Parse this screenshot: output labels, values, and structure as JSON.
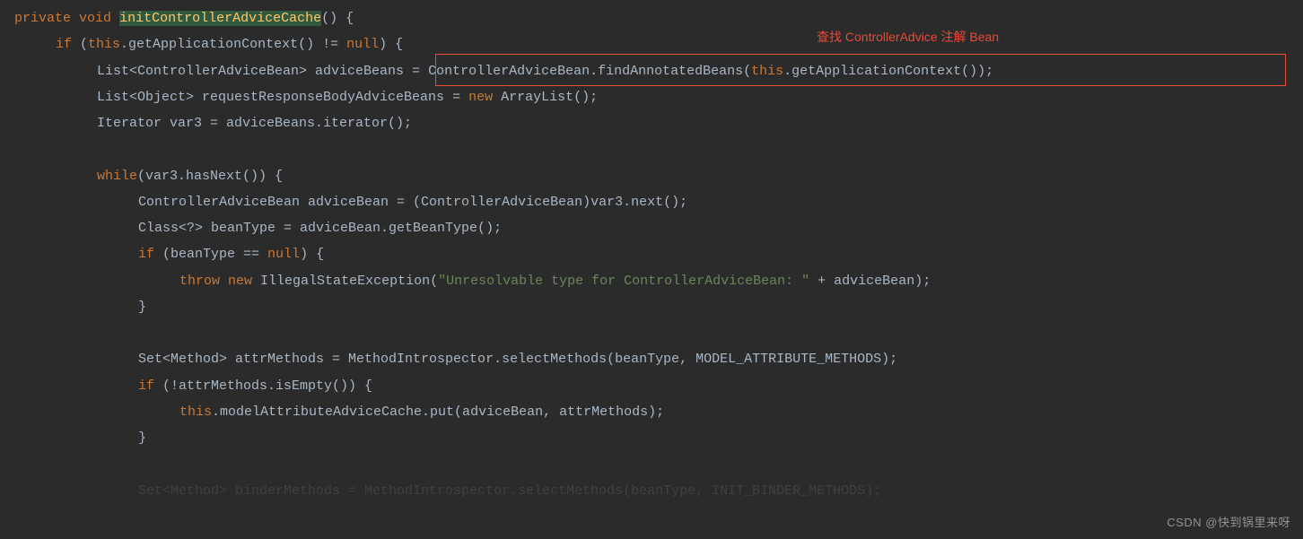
{
  "code": {
    "l1_private": "private",
    "l1_void": "void",
    "l1_method": "initControllerAdviceCache",
    "l1_rest": "() {",
    "l2_if": "if",
    "l2_open": " (",
    "l2_this1": "this",
    "l2_mid": ".getApplicationContext() != ",
    "l2_null": "null",
    "l2_rest": ") {",
    "l3_a": "List<ControllerAdviceBean> adviceBeans = ",
    "l3_b": "ControllerAdviceBean.findAnnotatedBeans(",
    "l3_this": "this",
    "l3_c": ".getApplicationContext());",
    "l4_a": "List<Object> requestResponseBodyAdviceBeans = ",
    "l4_new": "new",
    "l4_b": " ArrayList();",
    "l5": "Iterator var3 = adviceBeans.iterator();",
    "l7_while": "while",
    "l7_rest": "(var3.hasNext()) {",
    "l8": "ControllerAdviceBean adviceBean = (ControllerAdviceBean)var3.next();",
    "l9": "Class<?> beanType = adviceBean.getBeanType();",
    "l10_if": "if",
    "l10_mid": " (beanType == ",
    "l10_null": "null",
    "l10_rest": ") {",
    "l11_throw": "throw",
    "l11_new": "new",
    "l11_mid": " IllegalStateException(",
    "l11_str": "\"Unresolvable type for ControllerAdviceBean: \"",
    "l11_rest": " + adviceBean);",
    "l12": "}",
    "l14": "Set<Method> attrMethods = MethodIntrospector.selectMethods(beanType, MODEL_ATTRIBUTE_METHODS);",
    "l15_if": "if",
    "l15_rest": " (!attrMethods.isEmpty()) {",
    "l16_this": "this",
    "l16_rest": ".modelAttributeAdviceCache.put(adviceBean, attrMethods);",
    "l17": "}",
    "l_fade": "Set<Method> binderMethods = MethodIntrospector.selectMethods(beanType, INIT_BINDER_METHODS);"
  },
  "annotation": "查找 ControllerAdvice 注解 Bean",
  "watermark": "CSDN @快到锅里来呀"
}
